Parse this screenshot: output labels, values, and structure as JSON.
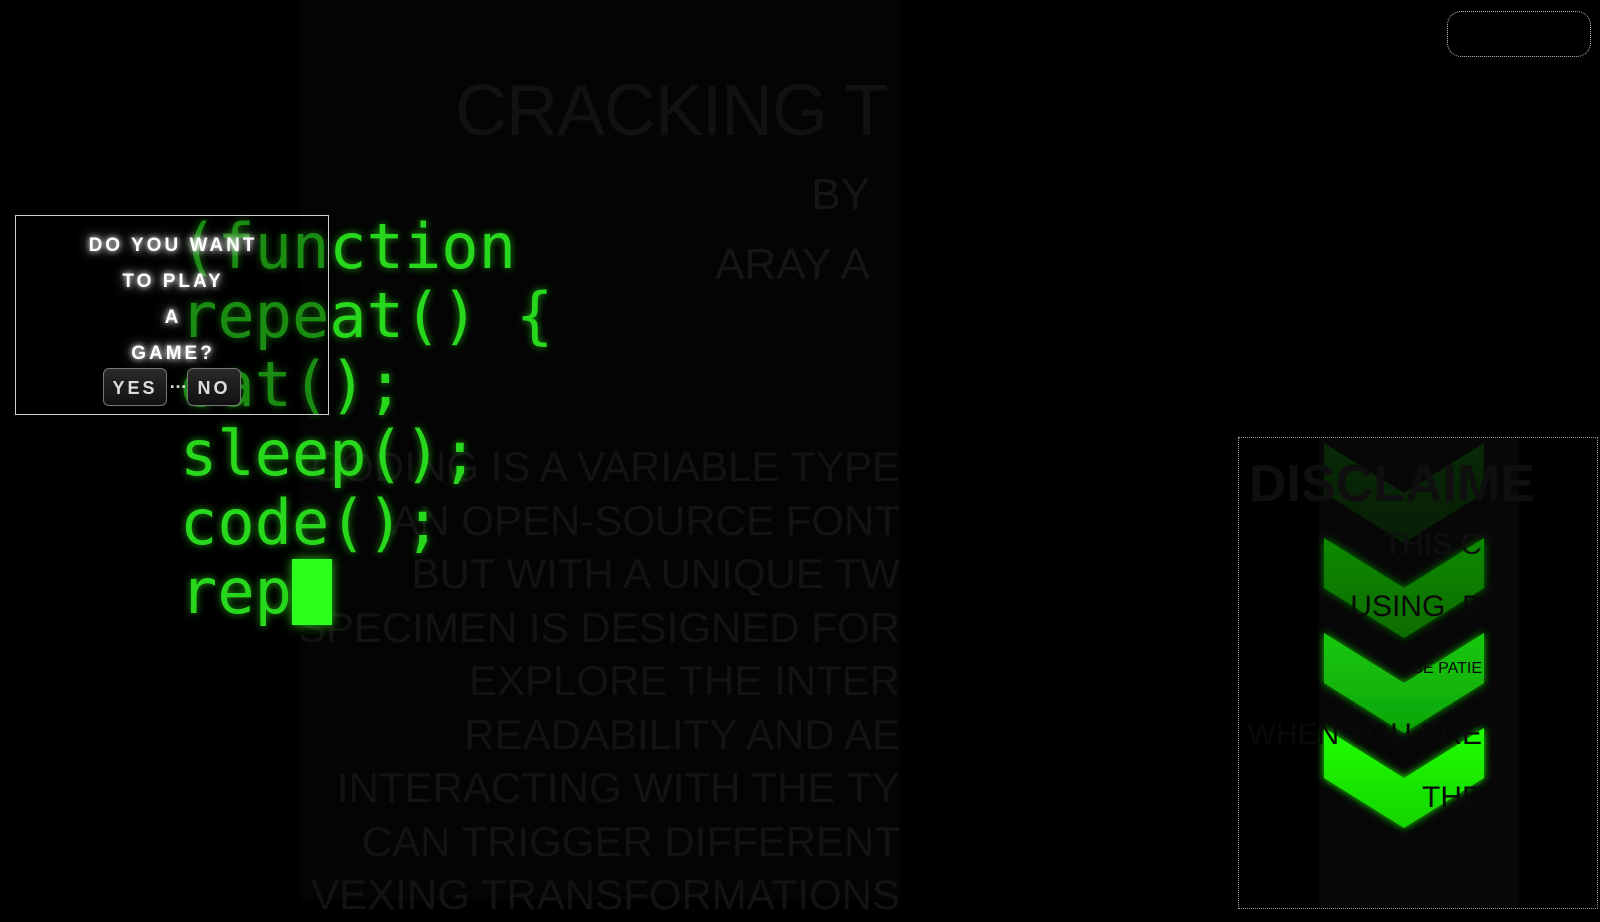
{
  "colors": {
    "code_green": "#28d81c",
    "chevron_green": "#1eff00",
    "background": "#000000",
    "dialog_border": "#cfcfcf"
  },
  "header": {
    "title": "CRACKING T",
    "byline_1": "BY",
    "byline_2": "ARAY A"
  },
  "body_lines": [
    "CODING IS A VARIABLE TYPE",
    "AN OPEN-SOURCE FONT",
    "BUT WITH A UNIQUE TW",
    "SPECIMEN IS DESIGNED FOR",
    "EXPLORE THE INTER",
    "READABILITY AND AE",
    "INTERACTING WITH THE TY",
    "CAN TRIGGER DIFFERENT",
    "VEXING TRANSFORMATIONS"
  ],
  "code_lines": [
    "(function",
    "repeat() {",
    "eat();",
    "sleep();",
    "code();",
    "rep"
  ],
  "dialog": {
    "lines": [
      "DO YOU WANT",
      "TO PLAY",
      "A",
      "GAME?"
    ],
    "yes_label": "YES",
    "ellipsis": "…",
    "no_label": "NO"
  },
  "disclaimer": {
    "title": "DISCLAIME",
    "lines": [
      "THIS C",
      "USING, B",
      "BE PATIE",
      "WHEN YOU BRE",
      "THE"
    ],
    "chevron_icon": "chevron-down-icon"
  }
}
